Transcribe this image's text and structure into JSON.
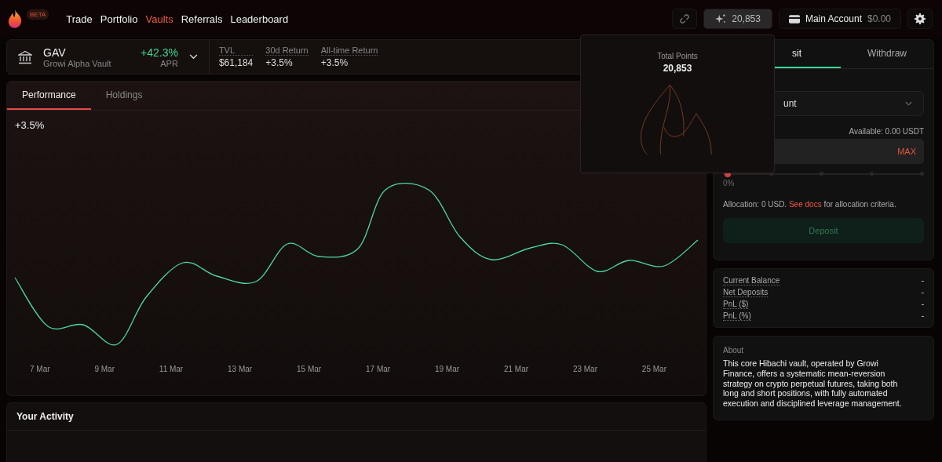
{
  "nav": {
    "badge": "BETA",
    "links": [
      {
        "label": "Trade",
        "selected": false
      },
      {
        "label": "Portfolio",
        "selected": false
      },
      {
        "label": "Vaults",
        "selected": true
      },
      {
        "label": "Referrals",
        "selected": false
      },
      {
        "label": "Leaderboard",
        "selected": false
      }
    ]
  },
  "toolbar": {
    "points": "20,853",
    "account_label": "Main Account",
    "account_balance": "$0.00"
  },
  "points_popover": {
    "title": "Total Points",
    "value": "20,853"
  },
  "vault": {
    "symbol": "GAV",
    "name": "Growi Alpha Vault",
    "apr": "+42.3%",
    "apr_label": "APR",
    "stats": [
      {
        "label": "TVL",
        "value": "$61,184"
      },
      {
        "label": "30d Return",
        "value": "+3.5%"
      },
      {
        "label": "All-time Return",
        "value": "+3.5%"
      }
    ]
  },
  "performance": {
    "tabs": [
      {
        "label": "Performance",
        "selected": true
      },
      {
        "label": "Holdings",
        "selected": false
      }
    ],
    "return": "+3.5%",
    "x_labels": [
      "7 Mar",
      "9 Mar",
      "11 Mar",
      "13 Mar",
      "15 Mar",
      "17 Mar",
      "19 Mar",
      "21 Mar",
      "23 Mar",
      "25 Mar"
    ]
  },
  "activity": {
    "title": "Your Activity"
  },
  "deposit": {
    "tabs": [
      {
        "label": "sit",
        "selected": true
      },
      {
        "label": "Withdraw",
        "selected": false
      }
    ],
    "account_select": "unt",
    "available": "Available: 0.00 USDT",
    "max": "MAX",
    "slider": {
      "level": 0,
      "reading": "0%"
    },
    "allocation": {
      "text": "Allocation: 0 USD.",
      "link": "See docs",
      "suffix": "for allocation criteria."
    },
    "button": {
      "label": "Deposit",
      "disabled": true
    }
  },
  "balances": [
    {
      "label": "Current Balance",
      "value": "-"
    },
    {
      "label": "Net Deposits",
      "value": "-"
    },
    {
      "label": "PnL ($)",
      "value": "-"
    },
    {
      "label": "PnL (%)",
      "value": "-"
    }
  ],
  "about": {
    "title": "About",
    "text": "This core Hibachi vault, operated by Growi Finance, offers a systematic mean-reversion strategy on crypto perpetual futures, taking both long and short positions, with fully automated execution and disciplined leverage management."
  }
}
